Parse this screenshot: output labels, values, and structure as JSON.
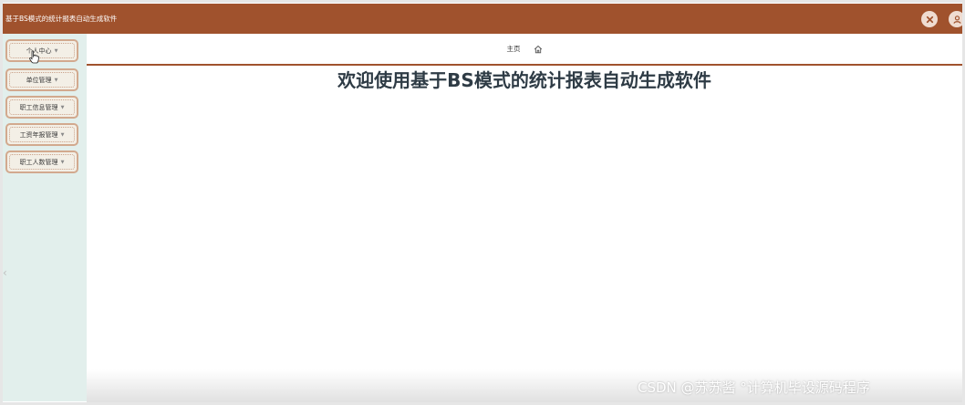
{
  "header": {
    "app_title": "基于BS模式的统计报表自动生成软件",
    "icons": [
      "close-icon",
      "user-icon"
    ],
    "bar_color": "#a0522d"
  },
  "sidebar": {
    "items": [
      {
        "label": "个人中心"
      },
      {
        "label": "单位管理"
      },
      {
        "label": "职工信息管理"
      },
      {
        "label": "工资年报管理"
      },
      {
        "label": "职工人数管理"
      }
    ],
    "background": "#e2efec"
  },
  "breadcrumb": {
    "label": "主页",
    "icon": "home-icon"
  },
  "main": {
    "welcome": "欢迎使用基于BS模式的统计报表自动生成软件"
  },
  "watermark": "CSDN @苏苏酱    °计算机毕设源码程序"
}
